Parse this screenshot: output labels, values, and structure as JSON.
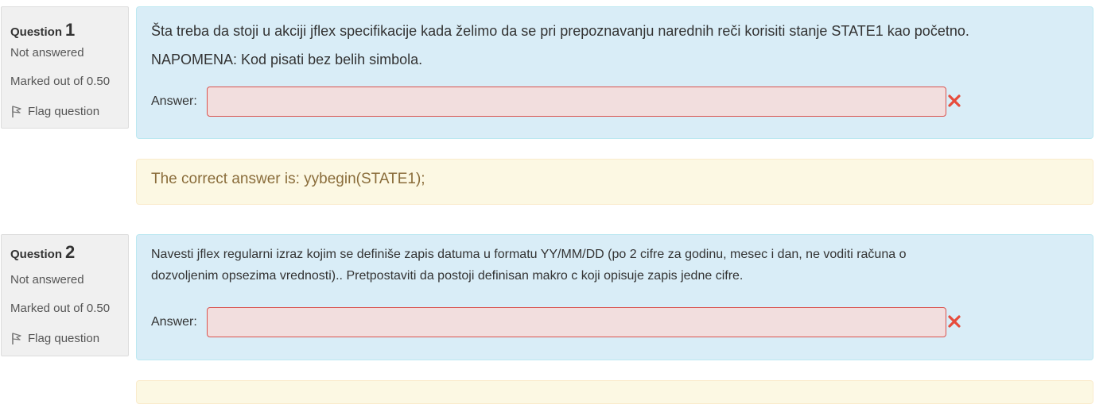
{
  "questions": [
    {
      "label": "Question",
      "number": "1",
      "state": "Not answered",
      "grade": "Marked out of 0.50",
      "flag_label": "Flag question",
      "text_lines": [
        "Šta treba da stoji u akciji jflex specifikacije kada želimo da se pri prepoznavanju narednih reči korisiti stanje STATE1 kao početno.",
        "NAPOMENA: Kod pisati bez belih simbola."
      ],
      "answer_label": "Answer:",
      "answer_value": "",
      "correct_answer": "The correct answer is: yybegin(STATE1);"
    },
    {
      "label": "Question",
      "number": "2",
      "state": "Not answered",
      "grade": "Marked out of 0.50",
      "flag_label": "Flag question",
      "text_lines": [
        "Navesti jflex regularni izraz kojim se definiše zapis datuma u formatu YY/MM/DD (po 2 cifre za godinu, mesec i dan, ne voditi računa o",
        "dozvoljenim opsezima vrednosti).. Pretpostaviti da postoji definisan makro c koji opisuje zapis jedne cifre."
      ],
      "answer_label": "Answer:",
      "answer_value": ""
    }
  ],
  "colors": {
    "info_bg": "#f0f0f0",
    "formulation_bg": "#d9edf7",
    "input_error_bg": "#f2dede",
    "input_error_border": "#d9534f",
    "incorrect_icon": "#e74c3c",
    "outcome_bg": "#fcf8e3",
    "outcome_text": "#8a6d3b"
  },
  "icons": {
    "flag": "flag-icon",
    "incorrect": "incorrect-x-icon"
  }
}
